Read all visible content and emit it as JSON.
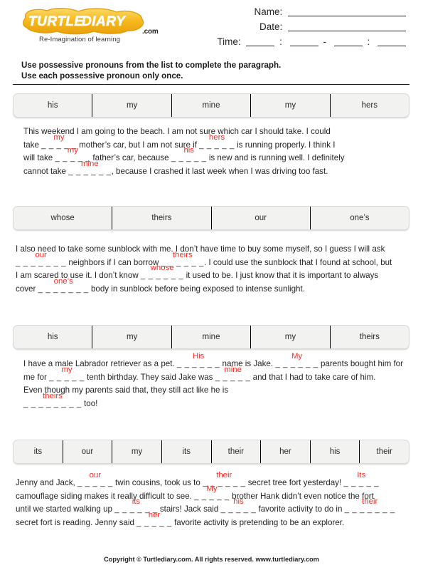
{
  "brand": {
    "logo_text": "TURTLE DIARY",
    "logo_suffix": ".com",
    "tagline": "Re-Imagination of learning",
    "logo_color": "#f5b21c"
  },
  "header": {
    "name_label": "Name:",
    "date_label": "Date:",
    "time_label": "Time:",
    "time_sep1": ":",
    "time_dash": "-",
    "time_sep2": ":"
  },
  "instructions": {
    "line1": "Use possessive pronouns from the list to complete the paragraph.",
    "line2": "Use each possessive pronoun only once."
  },
  "answer_color": "#ff2a22",
  "sections": [
    {
      "bank": [
        "his",
        "my",
        "mine",
        "my",
        "hers"
      ],
      "lines": [
        [
          {
            "t": "text",
            "v": "This weekend I am going to the beach. I am not sure which car I should take. I could"
          }
        ],
        [
          {
            "t": "text",
            "v": "take "
          },
          {
            "t": "blank",
            "v": "my",
            "dashes": "_ _ _ _ _"
          },
          {
            "t": "text",
            "v": " mother’s car, but I am not sure if "
          },
          {
            "t": "blank",
            "v": "hers",
            "dashes": "_ _ _ _ _"
          },
          {
            "t": "text",
            "v": " is running properly. I think I"
          }
        ],
        [
          {
            "t": "text",
            "v": "will take "
          },
          {
            "t": "blank",
            "v": "my",
            "dashes": "_ _ _ _ _"
          },
          {
            "t": "text",
            "v": " father’s car, because "
          },
          {
            "t": "blank",
            "v": "his",
            "dashes": "_ _ _ _ _"
          },
          {
            "t": "text",
            "v": " is new and is running well. I definitely"
          }
        ],
        [
          {
            "t": "text",
            "v": "cannot take "
          },
          {
            "t": "blank",
            "v": "mine",
            "dashes": "_ _ _ _ _ _"
          },
          {
            "t": "text",
            "v": ", because I crashed it last week when I was driving too fast."
          }
        ]
      ]
    },
    {
      "bank": [
        "whose",
        "theirs",
        "our",
        "one’s"
      ],
      "lines": [
        [
          {
            "t": "text",
            "v": "I also need to take some sunblock with me. I don’t have time to buy some myself, so I guess I will ask"
          }
        ],
        [
          {
            "t": "blank",
            "v": "our",
            "dashes": "_ _ _ _ _ _ _"
          },
          {
            "t": "text",
            "v": " neighbors if I can borrow "
          },
          {
            "t": "blank",
            "v": "theirs",
            "dashes": "_ _ _ _ _ _"
          },
          {
            "t": "text",
            "v": ". I could use the sunblock that I found at school, but"
          }
        ],
        [
          {
            "t": "text",
            "v": "I am scared to use it. I don’t know "
          },
          {
            "t": "blank",
            "v": "whose",
            "dashes": "_ _ _ _ _ _"
          },
          {
            "t": "text",
            "v": " it used to be. I just know that it is important to always"
          }
        ],
        [
          {
            "t": "text",
            "v": "cover "
          },
          {
            "t": "blank",
            "v": "one’s",
            "dashes": "_ _ _ _ _ _ _"
          },
          {
            "t": "text",
            "v": " body in sunblock before being exposed to intense sunlight."
          }
        ]
      ]
    },
    {
      "bank": [
        "his",
        "my",
        "mine",
        "my",
        "theirs"
      ],
      "lines": [
        [
          {
            "t": "text",
            "v": "I have a male Labrador retriever as a pet. "
          },
          {
            "t": "blank",
            "v": "His",
            "dashes": "_ _ _ _ _ _"
          },
          {
            "t": "text",
            "v": " name is Jake. "
          },
          {
            "t": "blank",
            "v": "My",
            "dashes": "_ _ _ _ _ _"
          },
          {
            "t": "text",
            "v": " parents bought him for"
          }
        ],
        [
          {
            "t": "text",
            "v": "me for "
          },
          {
            "t": "blank",
            "v": "my",
            "dashes": "_ _ _ _ _"
          },
          {
            "t": "text",
            "v": " tenth birthday. They said Jake was "
          },
          {
            "t": "blank",
            "v": "mine",
            "dashes": "_ _ _ _ _"
          },
          {
            "t": "text",
            "v": " and that I had to take care of him."
          }
        ],
        [
          {
            "t": "text",
            "v": "Even though my parents said that, they still act like he is"
          }
        ],
        [
          {
            "t": "blank",
            "v": "theirs",
            "dashes": "_ _ _ _ _ _ _ _"
          },
          {
            "t": "text",
            "v": " too!"
          }
        ]
      ]
    },
    {
      "bank": [
        "its",
        "our",
        "my",
        "its",
        "their",
        "her",
        "his",
        "their"
      ],
      "lines": [
        [
          {
            "t": "text",
            "v": "Jenny and Jack, "
          },
          {
            "t": "blank",
            "v": "our",
            "dashes": "_ _ _ _ _"
          },
          {
            "t": "text",
            "v": " twin cousins, took us to "
          },
          {
            "t": "blank",
            "v": "their",
            "dashes": "_ _ _ _ _ _"
          },
          {
            "t": "text",
            "v": " secret tree fort yesterday! "
          },
          {
            "t": "blank",
            "v": "Its",
            "dashes": "_ _ _ _ _"
          }
        ],
        [
          {
            "t": "text",
            "v": "camouflage siding makes it really difficult to see. "
          },
          {
            "t": "blank",
            "v": "My",
            "dashes": "_ _ _ _ _"
          },
          {
            "t": "text",
            "v": " brother Hank didn’t even notice the fort"
          }
        ],
        [
          {
            "t": "text",
            "v": "until we started walking up "
          },
          {
            "t": "blank",
            "v": "its",
            "dashes": "_ _ _ _ _ _"
          },
          {
            "t": "text",
            "v": " stairs! Jack said "
          },
          {
            "t": "blank",
            "v": "his",
            "dashes": "_ _ _ _ _"
          },
          {
            "t": "text",
            "v": " favorite activity to do in "
          },
          {
            "t": "blank",
            "v": "their",
            "dashes": "_ _ _ _ _ _ _"
          }
        ],
        [
          {
            "t": "text",
            "v": "secret fort is reading. Jenny said "
          },
          {
            "t": "blank",
            "v": "her",
            "dashes": "_ _ _ _ _"
          },
          {
            "t": "text",
            "v": " favorite activity is pretending to be an explorer."
          }
        ]
      ]
    }
  ],
  "footer": {
    "text": "Copyright © Turtlediary.com. All rights reserved. www.turtlediary.com"
  }
}
